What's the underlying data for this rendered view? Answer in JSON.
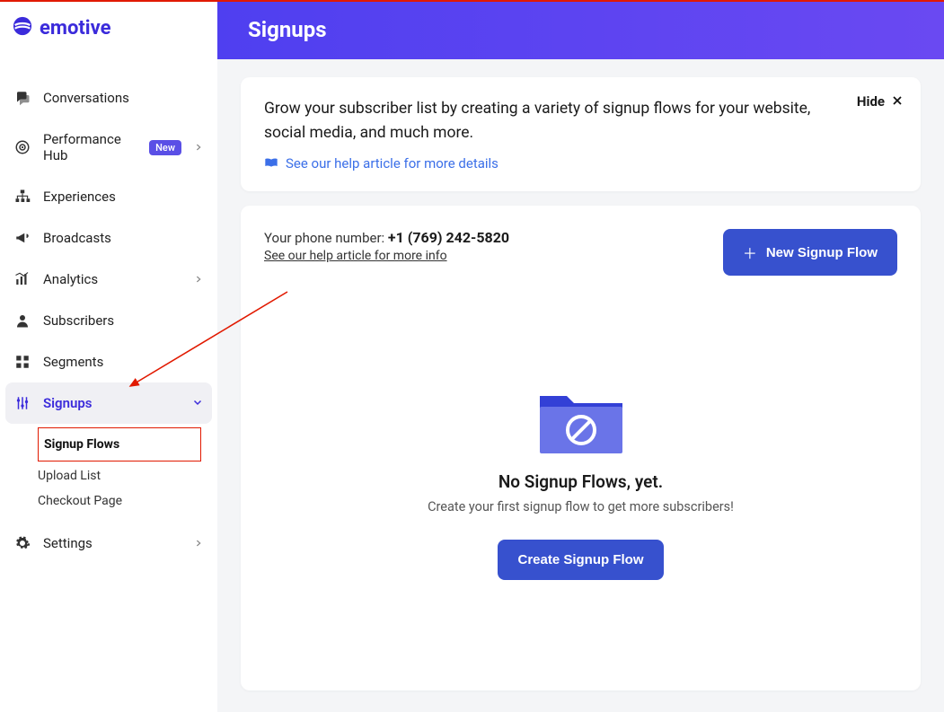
{
  "brand": {
    "name": "emotive"
  },
  "sidebar": {
    "items": [
      {
        "label": "Conversations"
      },
      {
        "label": "Performance Hub",
        "badge": "New",
        "hasChevron": true
      },
      {
        "label": "Experiences"
      },
      {
        "label": "Broadcasts"
      },
      {
        "label": "Analytics",
        "hasChevron": true
      },
      {
        "label": "Subscribers"
      },
      {
        "label": "Segments"
      },
      {
        "label": "Signups",
        "active": true,
        "hasChevron": true
      },
      {
        "label": "Settings",
        "hasChevron": true
      }
    ],
    "signupsSub": [
      {
        "label": "Signup Flows",
        "selected": true
      },
      {
        "label": "Upload List"
      },
      {
        "label": "Checkout Page"
      }
    ]
  },
  "header": {
    "title": "Signups"
  },
  "intro": {
    "text": "Grow your subscriber list by creating a variety of signup flows for your website, social media, and much more.",
    "helpLink": "See our help article for more details",
    "hide": "Hide"
  },
  "phone": {
    "label": "Your phone number: ",
    "number": "+1 (769) 242-5820",
    "help": "See our help article for more info",
    "newBtn": "New Signup Flow"
  },
  "empty": {
    "title": "No Signup Flows, yet.",
    "subtitle": "Create your first signup flow to get more subscribers!",
    "cta": "Create Signup Flow"
  }
}
